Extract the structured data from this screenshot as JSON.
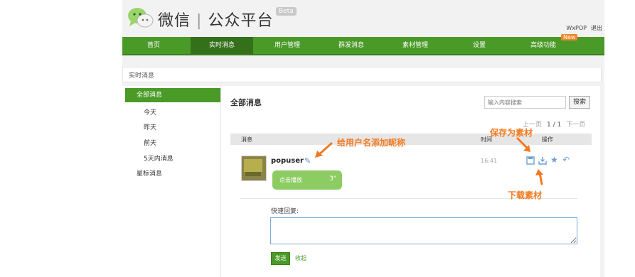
{
  "header": {
    "brand_wechat": "微信",
    "brand_platform": "公众平台",
    "beta": "Beta",
    "account": "WxPOP",
    "logout": "退出"
  },
  "nav": {
    "items": [
      "首页",
      "实时消息",
      "用户管理",
      "群发消息",
      "素材管理",
      "设置",
      "高级功能"
    ],
    "new_badge": "New",
    "active_index": 1
  },
  "breadcrumb": "实时消息",
  "sidebar": {
    "items": [
      "全部消息",
      "今天",
      "昨天",
      "前天",
      "5天内消息",
      "星标消息"
    ],
    "active_index": 0
  },
  "main": {
    "title": "全部消息",
    "search": {
      "placeholder": "输入内容搜索",
      "button": "搜索"
    },
    "pager": {
      "prev": "上一页",
      "current": "1 / 1",
      "next": "下一页"
    },
    "columns": {
      "message": "消息",
      "time": "时间",
      "action": "操作"
    },
    "message": {
      "username": "popuser",
      "bubble_text": "点击播放",
      "duration": "3\"",
      "time": "16:41",
      "icons": [
        "save-icon",
        "download-icon",
        "star-icon",
        "reply-icon"
      ]
    },
    "quick_reply": {
      "label": "快速回复:",
      "send": "发送",
      "collapse": "收起"
    }
  },
  "annotations": {
    "nickname": "给用户名添加昵称",
    "save_material": "保存为素材",
    "download_material": "下载素材"
  },
  "colors": {
    "brand_green": "#4a9a27",
    "annotation_orange": "#f37920",
    "bubble_green": "#8ccc62"
  }
}
